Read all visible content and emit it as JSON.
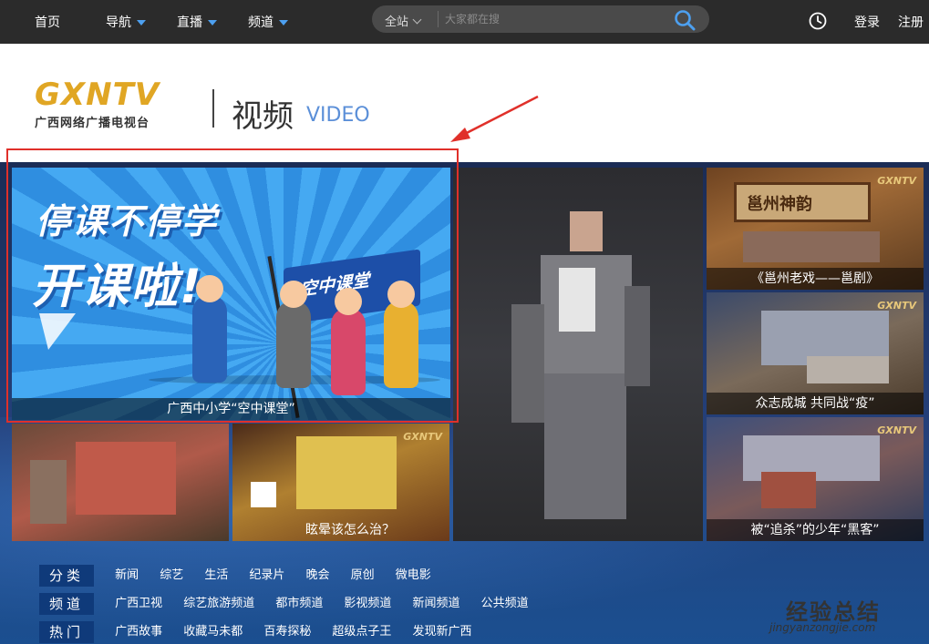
{
  "topnav": {
    "home": "首页",
    "guide": "导航",
    "live": "直播",
    "channel": "频道",
    "login": "登录",
    "register": "注册"
  },
  "search": {
    "scope": "全站",
    "placeholder": "大家都在搜"
  },
  "brand": {
    "logo_text": "GXNTV",
    "logo_sub": "广西网络广播电视台",
    "section_title": "视频",
    "section_sub": "VIDEO"
  },
  "feature": {
    "line1": "停课不停学",
    "line2": "开课啦!",
    "flag": "空中课堂",
    "caption": "广西中小学“空中课堂”"
  },
  "tiles": {
    "r1_caption": "《邕州老戏——邕剧》",
    "r1_sign": "邕州神韵",
    "r2_caption": "众志成城 共同战“疫”",
    "r3_caption": "被“追杀”的少年“黑客”",
    "b2_caption": "眩晕该怎么治？",
    "b1_caption": ""
  },
  "categories": [
    {
      "label": "分类",
      "links": [
        "新闻",
        "综艺",
        "生活",
        "纪录片",
        "晚会",
        "原创",
        "微电影"
      ]
    },
    {
      "label": "频道",
      "links": [
        "广西卫视",
        "综艺旅游频道",
        "都市频道",
        "影视频道",
        "新闻频道",
        "公共频道"
      ]
    },
    {
      "label": "热门",
      "links": [
        "广西故事",
        "收藏马未都",
        "百寿探秘",
        "超级点子王",
        "发现新广西"
      ]
    }
  ],
  "watermark": {
    "cn": "经验总结",
    "url": "jingyanzongjie.com"
  },
  "colors": {
    "nav_bg": "#2b2b2b",
    "accent_blue": "#4da0f0",
    "logo_gold": "#e0a624",
    "highlight_red": "#e0302a",
    "hero_bg": "#24407a"
  }
}
